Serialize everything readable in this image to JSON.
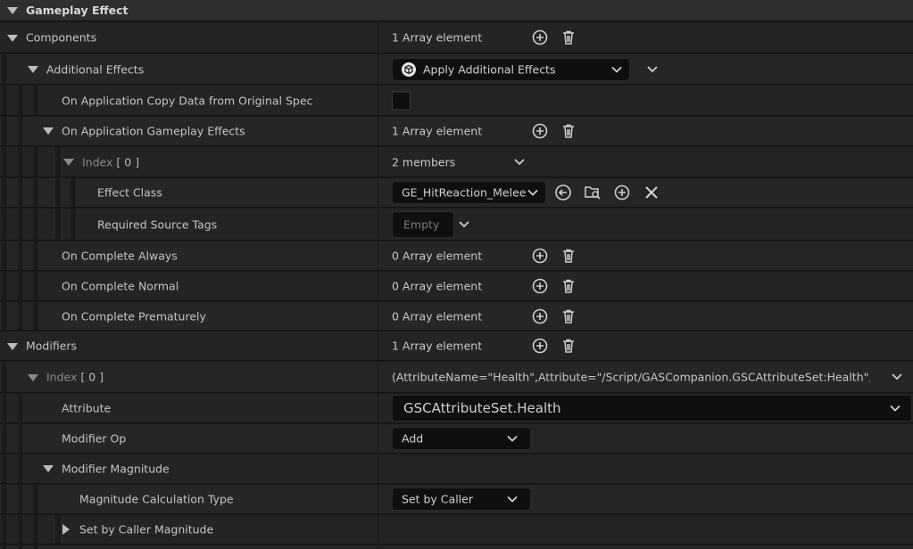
{
  "header": {
    "title": "Gameplay Effect"
  },
  "rows": {
    "components": {
      "label": "Components",
      "value": "1 Array element"
    },
    "additional_effects": {
      "label": "Additional Effects",
      "selected": "Apply Additional Effects"
    },
    "copy_data": {
      "label": "On Application Copy Data from Original Spec",
      "checked": false
    },
    "app_effects": {
      "label": "On Application Gameplay Effects",
      "value": "1 Array element"
    },
    "index0": {
      "label": "Index",
      "index": "[ 0 ]",
      "value": "2 members"
    },
    "effect_class": {
      "label": "Effect Class",
      "selected": "GE_HitReaction_Melee"
    },
    "source_tags": {
      "label": "Required Source Tags",
      "placeholder": "Empty"
    },
    "complete_always": {
      "label": "On Complete Always",
      "value": "0 Array element"
    },
    "complete_normal": {
      "label": "On Complete Normal",
      "value": "0 Array element"
    },
    "complete_prematurely": {
      "label": "On Complete Prematurely",
      "value": "0 Array element"
    },
    "modifiers": {
      "label": "Modifiers",
      "value": "1 Array element"
    },
    "mod_index0": {
      "label": "Index",
      "index": "[ 0 ]",
      "value": "(AttributeName=\"Health\",Attribute=\"/Script/GASCompanion.GSCAttributeSet:Health\",AttributeO"
    },
    "attribute": {
      "label": "Attribute",
      "selected": "GSCAttributeSet.Health"
    },
    "modifier_op": {
      "label": "Modifier Op",
      "selected": "Add"
    },
    "modifier_magnitude": {
      "label": "Modifier Magnitude"
    },
    "calc_type": {
      "label": "Magnitude Calculation Type",
      "selected": "Set by Caller"
    },
    "set_by_caller": {
      "label": "Set by Caller Magnitude"
    }
  },
  "icons": {
    "add": "add-circle-icon",
    "delete": "trash-icon",
    "browse": "browse-back-icon",
    "find": "folder-search-icon",
    "clear": "close-icon",
    "class": "unreal-class-icon"
  },
  "colors": {
    "background": "#242424",
    "header": "#2f2f2f",
    "field": "#0f0f0f",
    "text": "#c4c4c4"
  }
}
